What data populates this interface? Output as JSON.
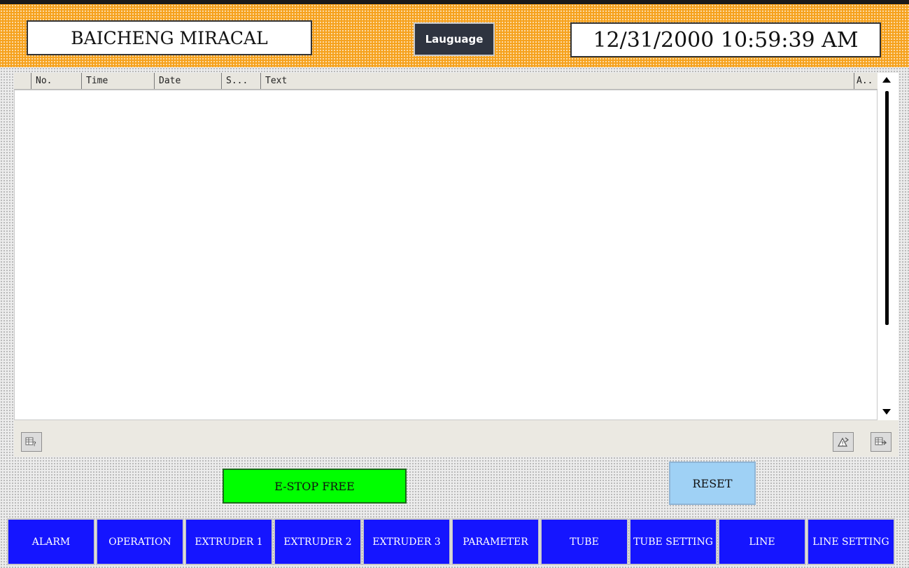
{
  "header": {
    "brand": "BAICHENG MIRACAL",
    "language_button": "Lauguage",
    "datetime": "12/31/2000 10:59:39 AM"
  },
  "alarm_table": {
    "columns": [
      "No.",
      "Time",
      "Date",
      "S...",
      "Text",
      "A.."
    ]
  },
  "toolbar": {
    "left_icon": "table-help-icon",
    "right_icons": [
      "acknowledge-icon",
      "table-settings-icon"
    ]
  },
  "controls": {
    "estop_label": "E-STOP FREE",
    "reset_label": "RESET"
  },
  "nav": {
    "items": [
      "ALARM",
      "OPERATION",
      "EXTRUDER 1",
      "EXTRUDER 2",
      "EXTRUDER 3",
      "PARAMETER",
      "TUBE",
      "TUBE SETTING",
      "LINE",
      "LINE SETTING"
    ]
  },
  "colors": {
    "header_orange": "#f6a21e",
    "estop_green": "#00ff00",
    "reset_blue": "#9fd1f5",
    "nav_blue": "#1515ff"
  }
}
